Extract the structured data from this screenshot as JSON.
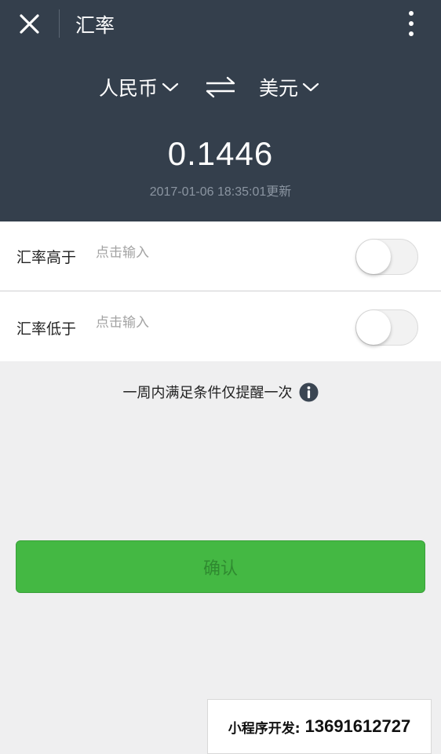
{
  "navbar": {
    "title": "汇率",
    "close_icon": "close-icon",
    "more_icon": "more-vertical-icon"
  },
  "currency": {
    "from": "人民币",
    "to": "美元",
    "swap_icon": "swap-arrows-icon"
  },
  "rate": {
    "value": "0.1446",
    "updated": "2017-01-06 18:35:01更新"
  },
  "alerts": {
    "high": {
      "label": "汇率高于",
      "placeholder": "点击输入",
      "enabled": false
    },
    "low": {
      "label": "汇率低于",
      "placeholder": "点击输入",
      "enabled": false
    }
  },
  "notice": {
    "text": "一周内满足条件仅提醒一次",
    "icon": "info-icon"
  },
  "confirm_label": "确认",
  "promo": {
    "label": "小程序开发:",
    "phone": "13691612727"
  },
  "colors": {
    "header_bg": "#343f4c",
    "confirm_bg": "#44b843",
    "page_bg": "#efeff0"
  }
}
